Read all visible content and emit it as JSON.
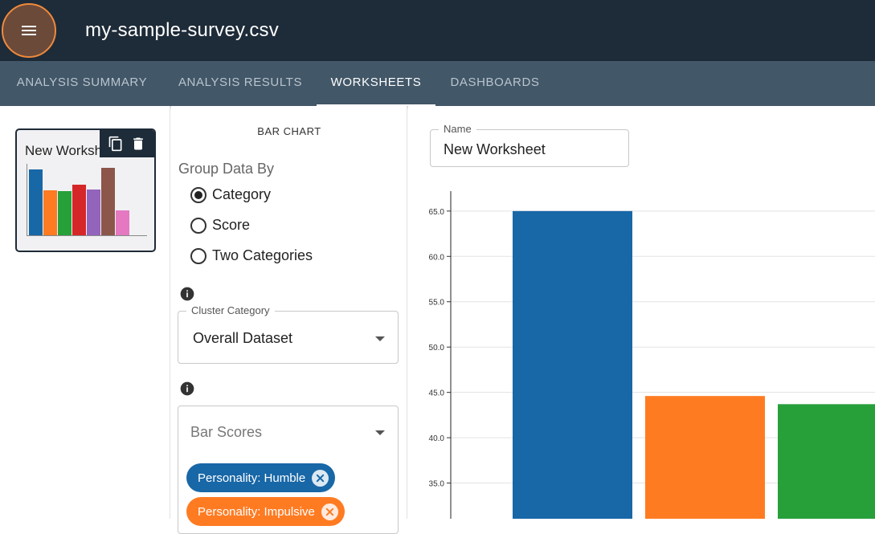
{
  "header": {
    "title": "my-sample-survey.csv",
    "menu_icon": "hamburger-menu-icon",
    "focus_color": "#f08a3c",
    "background": "#1e2b38"
  },
  "tabs": [
    {
      "label": "ANALYSIS SUMMARY",
      "active": false
    },
    {
      "label": "ANALYSIS RESULTS",
      "active": false
    },
    {
      "label": "WORKSHEETS",
      "active": true
    },
    {
      "label": "DASHBOARDS",
      "active": false
    }
  ],
  "worksheet_list": {
    "items": [
      {
        "title": "New Worksheet",
        "thumbnail_values": [
          65,
          44.5,
          43.5,
          50.5,
          45.5,
          67,
          25
        ],
        "thumbnail_colors": [
          "#1867a7",
          "#ff7b22",
          "#27a03a",
          "#d62728",
          "#9364bc",
          "#8c564b",
          "#e479c1"
        ],
        "actions": {
          "duplicate_icon": "copy-icon",
          "delete_icon": "trash-icon"
        }
      }
    ]
  },
  "config": {
    "chart_type": "BAR CHART",
    "group_by": {
      "label": "Group Data By",
      "options": [
        {
          "label": "Category",
          "selected": true
        },
        {
          "label": "Score",
          "selected": false
        },
        {
          "label": "Two Categories",
          "selected": false
        }
      ]
    },
    "cluster_category": {
      "legend": "Cluster Category",
      "value": "Overall Dataset"
    },
    "bar_scores": {
      "placeholder": "Bar Scores",
      "chips": [
        {
          "label": "Personality: Humble",
          "color": "#1867a7"
        },
        {
          "label": "Personality: Impulsive",
          "color": "#ff7b22"
        }
      ]
    }
  },
  "worksheet": {
    "name_label": "Name",
    "name_value": "New Worksheet"
  },
  "chart_data": {
    "type": "bar",
    "y_ticks": [
      "65.0",
      "60.0",
      "55.0",
      "50.0",
      "45.0",
      "40.0",
      "35.0"
    ],
    "ylim": [
      30,
      67.2
    ],
    "values": [
      65,
      44.6,
      43.7
    ],
    "colors": [
      "#1867a7",
      "#ff7b22",
      "#27a03a"
    ],
    "grid": true
  }
}
